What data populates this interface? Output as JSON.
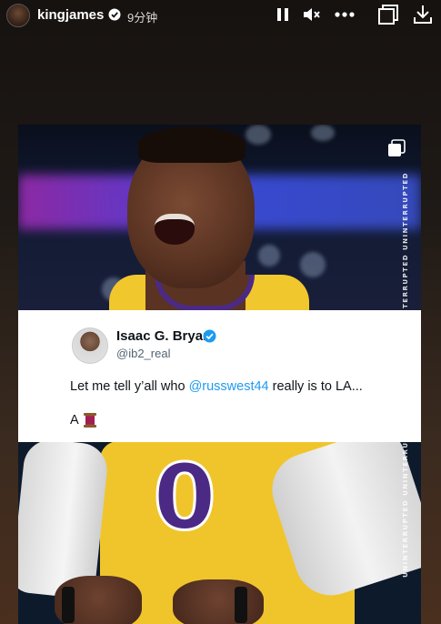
{
  "story": {
    "username": "kingjames",
    "time_ago": "9分钟",
    "controls": [
      "pause-icon",
      "mute-icon",
      "more-icon",
      "multi-page-icon",
      "download-icon"
    ]
  },
  "post": {
    "brand_strip": "UNINTERRUPTED UNINTERRUPTED UNINTERRUPTED UNINTERRUPTED UNINTERRUPTED",
    "jersey_number": "0",
    "tweet": {
      "display_name": "Isaac G. Bryan",
      "handle": "@ib2_real",
      "text_before": "Let me tell y’all who ",
      "mention": "@russwest44",
      "text_after": " really is to LA...",
      "line2": "A"
    }
  },
  "colors": {
    "accent_blue": "#1d9bf0",
    "lakers_gold": "#f0c52c",
    "lakers_purple": "#4b2a85"
  }
}
